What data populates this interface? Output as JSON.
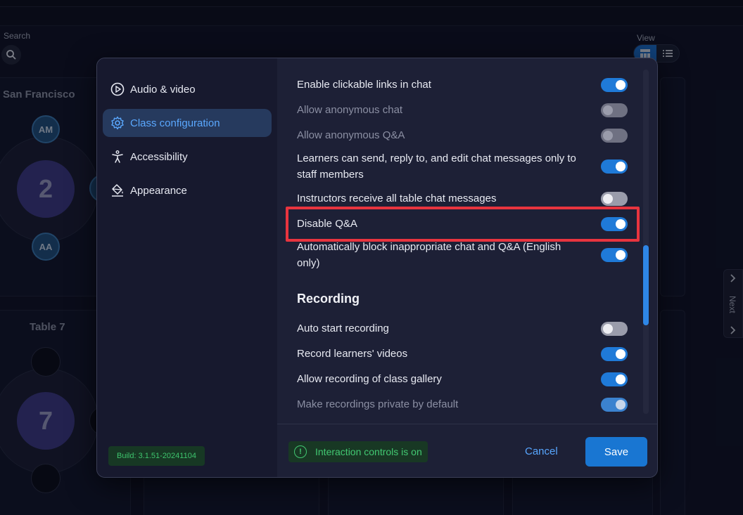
{
  "background": {
    "search_label": "Search",
    "view_label": "View",
    "tables": [
      {
        "title": "San Francisco",
        "number": "2",
        "seats": [
          "AM",
          "AA"
        ]
      },
      {
        "title": "Table 7",
        "number": "7"
      }
    ],
    "next_label": "Next"
  },
  "sidebar": {
    "items": [
      {
        "label": "Audio & video",
        "icon": "play-circle-icon"
      },
      {
        "label": "Class configuration",
        "icon": "gear-icon"
      },
      {
        "label": "Accessibility",
        "icon": "accessibility-icon"
      },
      {
        "label": "Appearance",
        "icon": "paint-bucket-icon"
      }
    ],
    "build": "Build: 3.1.51-20241104"
  },
  "settings": [
    {
      "label": "Enable clickable links in chat",
      "on": true,
      "enabled": true
    },
    {
      "label": "Allow anonymous chat",
      "on": false,
      "enabled": false
    },
    {
      "label": "Allow anonymous Q&A",
      "on": false,
      "enabled": false
    },
    {
      "label": "Learners can send, reply to, and edit chat messages only to staff members",
      "on": true,
      "enabled": true
    },
    {
      "label": "Instructors receive all table chat messages",
      "on": false,
      "enabled": true
    },
    {
      "label": "Disable Q&A",
      "on": true,
      "enabled": true
    },
    {
      "label": "Automatically block inappropriate chat and Q&A (English only)",
      "on": true,
      "enabled": true
    }
  ],
  "recording": {
    "heading": "Recording",
    "items": [
      {
        "label": "Auto start recording",
        "on": false,
        "enabled": true
      },
      {
        "label": "Record learners' videos",
        "on": true,
        "enabled": true
      },
      {
        "label": "Allow recording of class gallery",
        "on": true,
        "enabled": true
      },
      {
        "label": "Make recordings private by default",
        "on": true,
        "enabled": false
      }
    ]
  },
  "footer": {
    "notice": "Interaction controls is on",
    "cancel": "Cancel",
    "save": "Save"
  }
}
